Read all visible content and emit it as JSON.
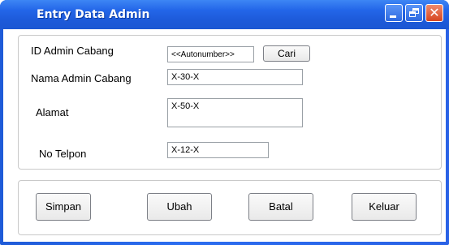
{
  "window": {
    "title": "Entry Data Admin"
  },
  "form": {
    "id_label": "ID Admin Cabang",
    "id_value": "<<Autonumber>>",
    "search_button": "Cari",
    "name_label": "Nama Admin Cabang",
    "name_value": "X-30-X",
    "address_label": "Alamat",
    "address_value": "X-50-X",
    "phone_label": "No Telpon",
    "phone_value": "X-12-X"
  },
  "actions": {
    "save": "Simpan",
    "edit": "Ubah",
    "cancel": "Batal",
    "exit": "Keluar"
  },
  "colors": {
    "titlebar": "#1f5bd8",
    "close_button": "#d6451f",
    "frame_border": "#c9c9c9"
  }
}
